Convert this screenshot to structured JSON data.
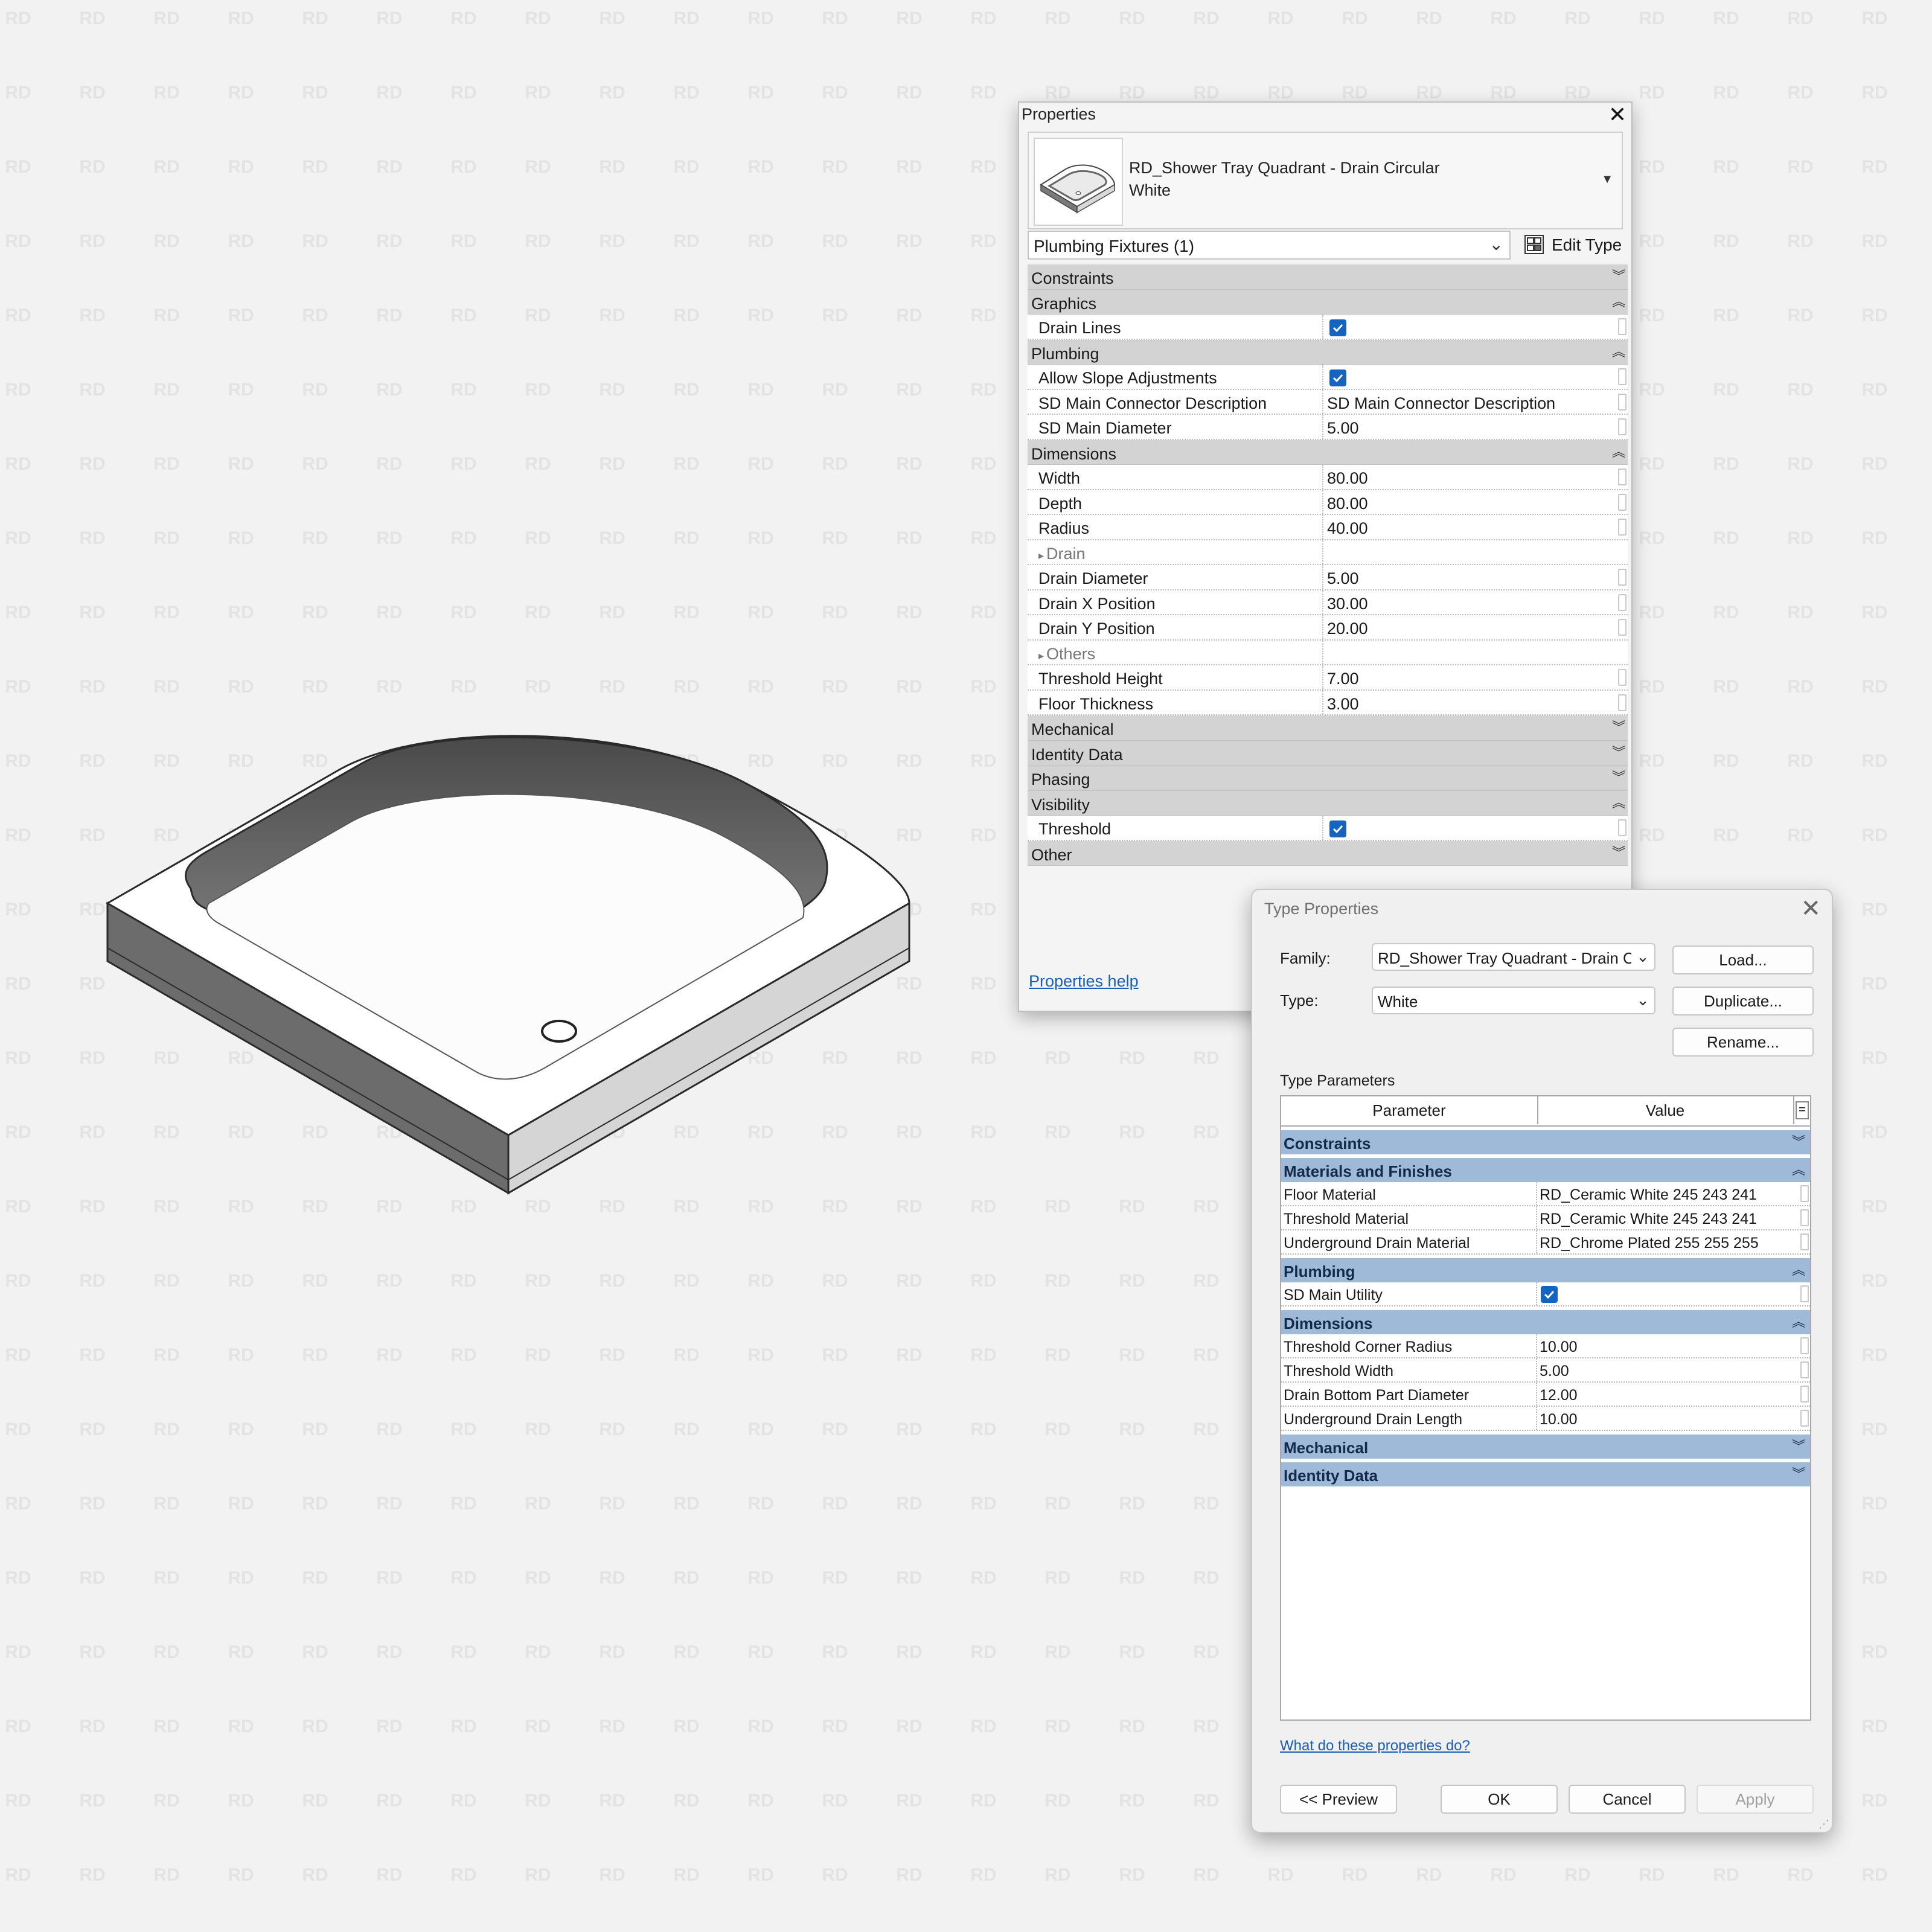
{
  "watermark": {
    "text": "RD"
  },
  "properties": {
    "title": "Properties",
    "family_line1": "RD_Shower Tray Quadrant - Drain Circular",
    "family_line2": "White",
    "selector": "Plumbing Fixtures (1)",
    "edit_type": "Edit Type",
    "help_link": "Properties help",
    "rows": [
      {
        "kind": "group",
        "label": "Constraints",
        "expanded": false
      },
      {
        "kind": "group",
        "label": "Graphics",
        "expanded": true
      },
      {
        "kind": "param",
        "name": "Drain Lines",
        "checked": true
      },
      {
        "kind": "group",
        "label": "Plumbing",
        "expanded": true
      },
      {
        "kind": "param",
        "name": "Allow Slope Adjustments",
        "checked": true
      },
      {
        "kind": "param",
        "name": "SD Main Connector Description",
        "value": "SD Main Connector Description"
      },
      {
        "kind": "param",
        "name": "SD Main Diameter",
        "value": "5.00"
      },
      {
        "kind": "group",
        "label": "Dimensions",
        "expanded": true
      },
      {
        "kind": "param",
        "name": "Width",
        "value": "80.00"
      },
      {
        "kind": "param",
        "name": "Depth",
        "value": "80.00"
      },
      {
        "kind": "param",
        "name": "Radius",
        "value": "40.00"
      },
      {
        "kind": "sub",
        "name": "Drain"
      },
      {
        "kind": "param",
        "name": "Drain Diameter",
        "value": "5.00"
      },
      {
        "kind": "param",
        "name": "Drain X Position",
        "value": "30.00"
      },
      {
        "kind": "param",
        "name": "Drain Y Position",
        "value": "20.00"
      },
      {
        "kind": "sub",
        "name": "Others"
      },
      {
        "kind": "param",
        "name": "Threshold Height",
        "value": "7.00"
      },
      {
        "kind": "param",
        "name": "Floor Thickness",
        "value": "3.00"
      },
      {
        "kind": "group",
        "label": "Mechanical",
        "expanded": false
      },
      {
        "kind": "group",
        "label": "Identity Data",
        "expanded": false
      },
      {
        "kind": "group",
        "label": "Phasing",
        "expanded": false
      },
      {
        "kind": "group",
        "label": "Visibility",
        "expanded": true
      },
      {
        "kind": "param",
        "name": "Threshold",
        "checked": true
      },
      {
        "kind": "group",
        "label": "Other",
        "expanded": false
      }
    ]
  },
  "type_properties": {
    "title": "Type Properties",
    "family_label": "Family:",
    "family_value": "RD_Shower Tray Quadrant - Drain Circular",
    "type_label": "Type:",
    "type_value": "White",
    "buttons": {
      "load": "Load...",
      "duplicate": "Duplicate...",
      "rename": "Rename..."
    },
    "section_label": "Type Parameters",
    "col_parameter": "Parameter",
    "col_value": "Value",
    "col_extra": "=",
    "rows": [
      {
        "kind": "group",
        "label": "Constraints",
        "expanded": false
      },
      {
        "kind": "group",
        "label": "Materials and Finishes",
        "expanded": true
      },
      {
        "kind": "param",
        "name": "Floor Material",
        "value": "RD_Ceramic White 245 243 241"
      },
      {
        "kind": "param",
        "name": "Threshold Material",
        "value": "RD_Ceramic White 245 243 241"
      },
      {
        "kind": "param",
        "name": "Underground Drain Material",
        "value": "RD_Chrome Plated 255 255 255"
      },
      {
        "kind": "group",
        "label": "Plumbing",
        "expanded": true
      },
      {
        "kind": "param",
        "name": "SD Main Utility",
        "checked": true
      },
      {
        "kind": "group",
        "label": "Dimensions",
        "expanded": true
      },
      {
        "kind": "param",
        "name": "Threshold Corner Radius",
        "value": "10.00"
      },
      {
        "kind": "param",
        "name": "Threshold Width",
        "value": "5.00"
      },
      {
        "kind": "param",
        "name": "Drain Bottom Part Diameter",
        "value": "12.00"
      },
      {
        "kind": "param",
        "name": "Underground Drain Length",
        "value": "10.00"
      },
      {
        "kind": "group",
        "label": "Mechanical",
        "expanded": false
      },
      {
        "kind": "group",
        "label": "Identity Data",
        "expanded": false
      }
    ],
    "help_link": "What do these properties do?",
    "footer": {
      "preview": "<< Preview",
      "ok": "OK",
      "cancel": "Cancel",
      "apply": "Apply"
    }
  },
  "colors": {
    "background": "#f2f2f2",
    "group_gray": "#d3d3d3",
    "group_blue": "#9fb9d9",
    "checkbox_blue": "#1565c0",
    "link_blue": "#1a5fb4"
  }
}
